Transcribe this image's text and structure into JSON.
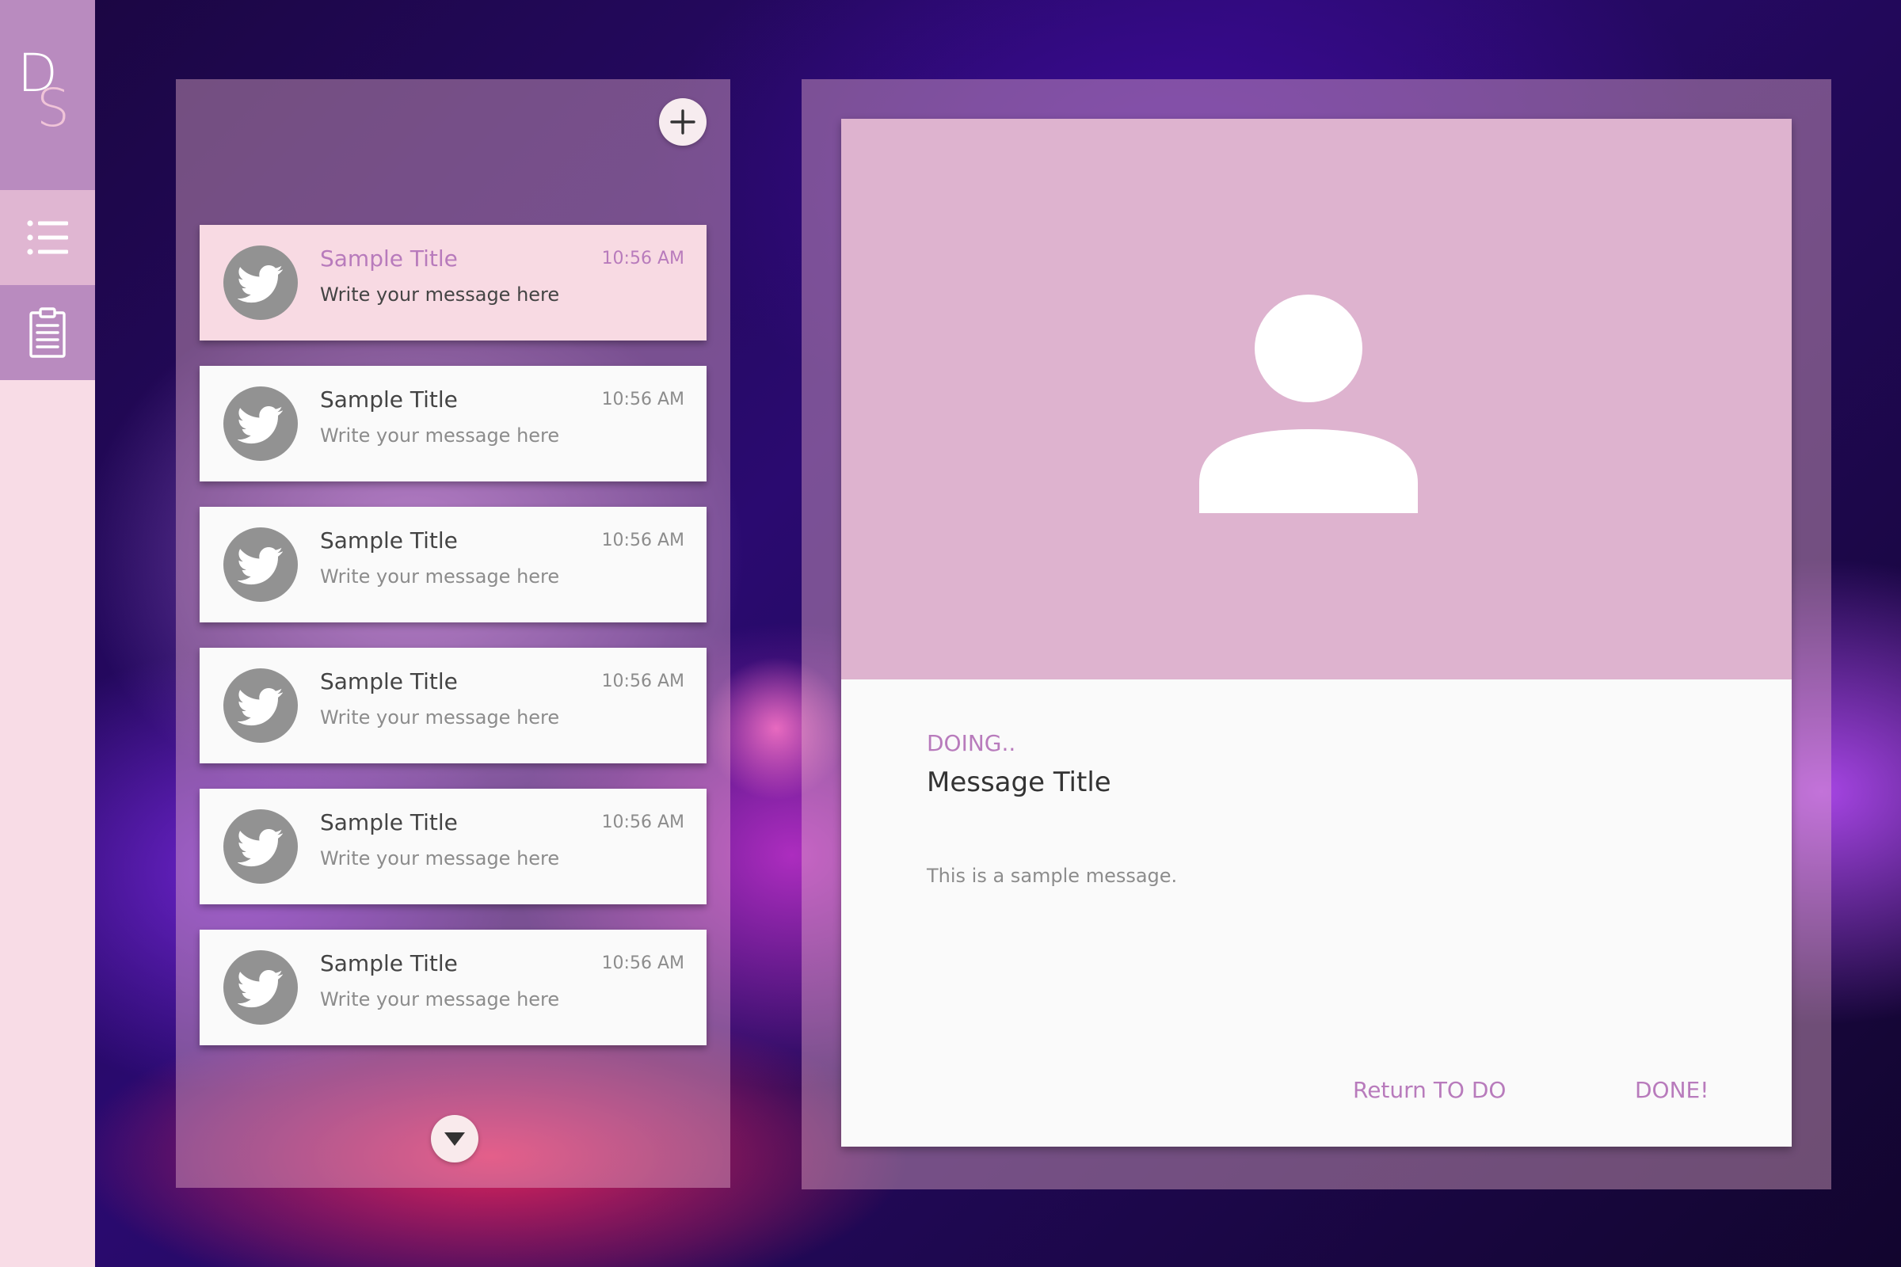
{
  "sidebar": {
    "logo": {
      "letter1": "D",
      "letter2": "S"
    },
    "nav": [
      {
        "icon": "list-icon"
      },
      {
        "icon": "clipboard-icon"
      }
    ]
  },
  "list": {
    "add_icon": "plus-icon",
    "scroll_icon": "caret-down-icon",
    "cards": [
      {
        "title": "Sample Title",
        "message": "Write your message here",
        "time": "10:56 AM",
        "active": true,
        "icon": "twitter-bird-icon"
      },
      {
        "title": "Sample Title",
        "message": "Write your message here",
        "time": "10:56 AM",
        "active": false,
        "icon": "twitter-bird-icon"
      },
      {
        "title": "Sample Title",
        "message": "Write your message here",
        "time": "10:56 AM",
        "active": false,
        "icon": "twitter-bird-icon"
      },
      {
        "title": "Sample Title",
        "message": "Write your message here",
        "time": "10:56 AM",
        "active": false,
        "icon": "twitter-bird-icon"
      },
      {
        "title": "Sample Title",
        "message": "Write your message here",
        "time": "10:56 AM",
        "active": false,
        "icon": "twitter-bird-icon"
      },
      {
        "title": "Sample Title",
        "message": "Write your message here",
        "time": "10:56 AM",
        "active": false,
        "icon": "twitter-bird-icon"
      }
    ]
  },
  "detail": {
    "hero_icon": "user-icon",
    "status": "DOING..",
    "title": "Message Title",
    "body": "This is a sample message.",
    "return_label": "Return TO DO",
    "done_label": "DONE!"
  },
  "colors": {
    "accent": "#b87bbc",
    "sidebar_bg": "#f8dce6",
    "logo_bg": "#b98bbf",
    "hero_bg": "#deb3cf",
    "active_card_bg": "#f8dae3",
    "card_bg": "#fafafa",
    "avatar_gray": "#929292"
  }
}
